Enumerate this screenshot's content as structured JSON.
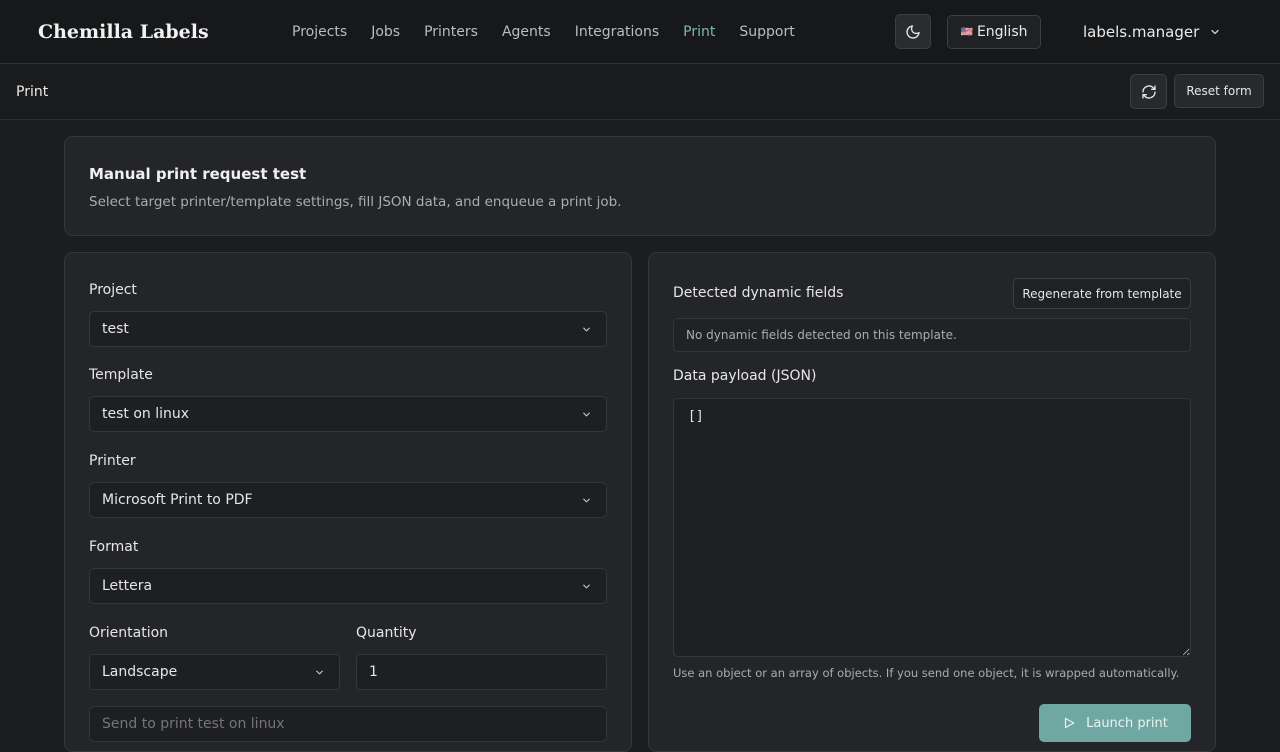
{
  "brand": "Chemilla Labels",
  "nav": {
    "items": [
      {
        "label": "Projects"
      },
      {
        "label": "Jobs"
      },
      {
        "label": "Printers"
      },
      {
        "label": "Agents"
      },
      {
        "label": "Integrations"
      },
      {
        "label": "Print",
        "active": true
      },
      {
        "label": "Support"
      }
    ]
  },
  "header": {
    "theme_icon": "moon-icon",
    "language": {
      "flag": "🇺🇸",
      "label": "English"
    },
    "user": "labels.manager"
  },
  "subbar": {
    "title": "Print",
    "refresh_icon": "refresh-icon",
    "reset_label": "Reset form"
  },
  "intro": {
    "title": "Manual print request test",
    "description": "Select target printer/template settings, fill JSON data, and enqueue a print job."
  },
  "form": {
    "project": {
      "label": "Project",
      "value": "test"
    },
    "template": {
      "label": "Template",
      "value": "test on linux"
    },
    "printer": {
      "label": "Printer",
      "value": "Microsoft Print to PDF"
    },
    "format": {
      "label": "Format",
      "value": "Lettera"
    },
    "orientation": {
      "label": "Orientation",
      "value": "Landscape"
    },
    "quantity": {
      "label": "Quantity",
      "value": "1"
    },
    "bottom_placeholder": "Send to print test on linux"
  },
  "payload": {
    "dynamic_label": "Detected dynamic fields",
    "regenerate_label": "Regenerate from template",
    "no_fields_text": "No dynamic fields detected on this template.",
    "json_label": "Data payload (JSON)",
    "json_value": "[]",
    "hint": "Use an object or an array of objects. If you send one object, it is wrapped automatically.",
    "launch_label": "Launch print"
  },
  "colors": {
    "accent": "#7fb7b1",
    "primary_button": "#6fa8a2",
    "background": "#1c1d1f",
    "card": "#242528"
  }
}
